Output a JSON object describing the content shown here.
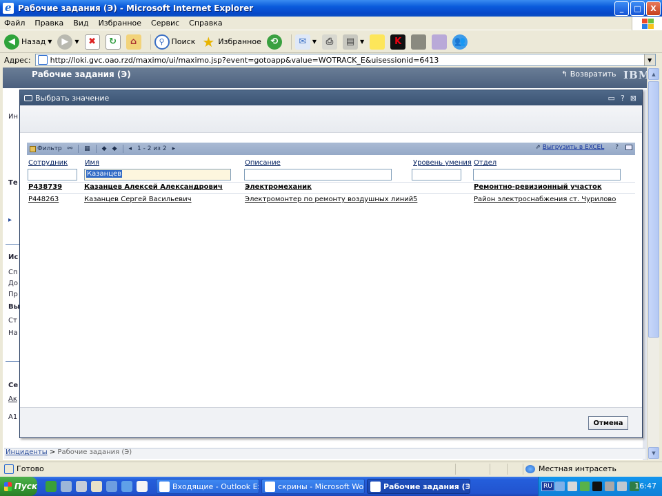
{
  "window": {
    "title": "Рабочие задания (Э) - Microsoft Internet Explorer",
    "controls": {
      "minimize": "_",
      "maximize": "□",
      "close": "X"
    }
  },
  "menu": [
    "Файл",
    "Правка",
    "Вид",
    "Избранное",
    "Сервис",
    "Справка"
  ],
  "toolbar": {
    "back_label": "Назад",
    "search_label": "Поиск",
    "favorites_label": "Избранное"
  },
  "address": {
    "label": "Адрес:",
    "url": "http://loki.gvc.oao.rzd/maximo/ui/maximo.jsp?event=gotoapp&value=WOTRACK_E&uisessionid=6413"
  },
  "app": {
    "title": "Рабочие задания (Э)",
    "back_label": "Возвратить",
    "logo": "IBM"
  },
  "background_fragments": [
    "Ин",
    "Те",
    "Ис",
    "Сп",
    "До",
    "Пр",
    "Вы",
    "Ст",
    "На",
    "Се",
    "Ак",
    "A1"
  ],
  "breadcrumb": {
    "root": "Инциденты",
    "separator": ">",
    "current": "Рабочие задания (Э)"
  },
  "dialog": {
    "title": "Выбрать значение",
    "title_controls": [
      "▭",
      "?",
      "⊠"
    ],
    "table_toolbar": {
      "filter_label": "Фильтр",
      "pager": "1 - 2 из 2",
      "export_label": "Выгрузить в EXCEL",
      "help": "?",
      "collapse": "▭"
    },
    "columns": [
      "Сотрудник",
      "Имя",
      "Описание",
      "Уровень умения",
      "Отдел"
    ],
    "filters": [
      "",
      "Казанцев",
      "",
      "",
      ""
    ],
    "rows": [
      {
        "employee": "P438739",
        "name": "Казанцев Алексей Александрович",
        "description": "Электромеханик",
        "skill": "",
        "department": "Ремонтно-ревизионный участок"
      },
      {
        "employee": "P448263",
        "name": "Казанцев Сергей Васильевич",
        "description": "Электромонтер по ремонту воздушных линий",
        "skill": "5",
        "department": "Район электроснабжения ст. Чурилово"
      }
    ],
    "cancel_label": "Отмена"
  },
  "statusbar": {
    "text": "Готово",
    "zone": "Местная интрасеть"
  },
  "taskbar": {
    "start_label": "Пуск",
    "tasks": [
      {
        "label": "Входящие - Outlook Exp..."
      },
      {
        "label": "скрины - Microsoft Word"
      },
      {
        "label": "Рабочие задания (Э) ..."
      }
    ],
    "tray": {
      "lang": "RU",
      "clock": "16:47"
    }
  },
  "colors": {
    "xp_title": "#0a5bdc",
    "app_header": "#4b607e",
    "dialog_title": "#3a5273",
    "table_toolbar": "#95a9c7",
    "link": "#10309c",
    "taskbar": "#245edb",
    "start_green": "#33962f"
  }
}
